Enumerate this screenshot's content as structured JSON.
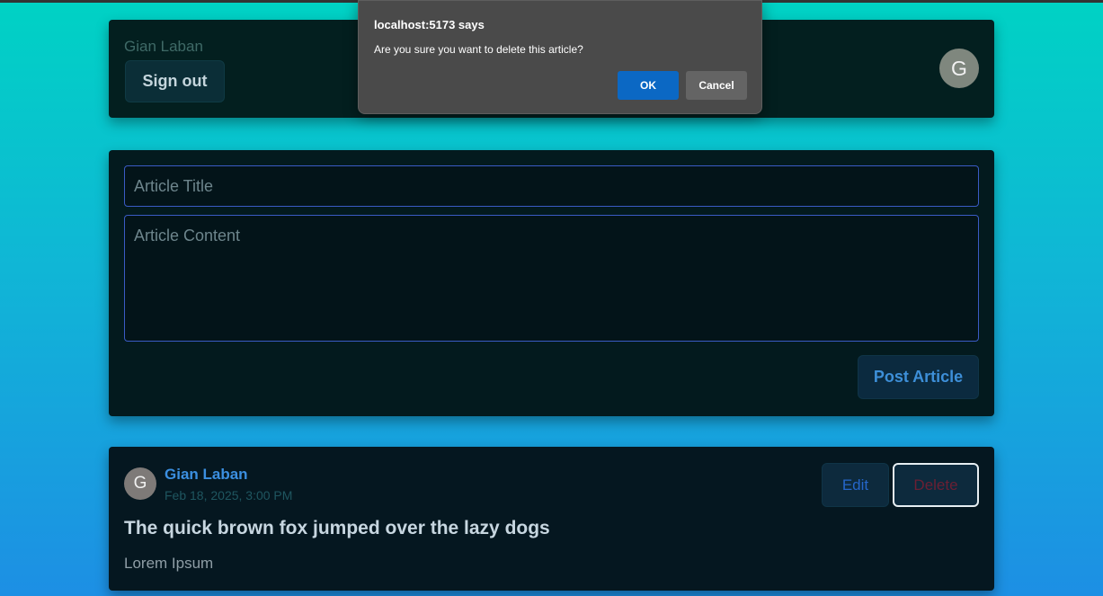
{
  "header": {
    "user_name": "Gian Laban",
    "signout_label": "Sign out",
    "avatar_letter": "G"
  },
  "form": {
    "title_placeholder": "Article Title",
    "content_placeholder": "Article Content",
    "title_value": "",
    "content_value": "",
    "post_label": "Post Article"
  },
  "article": {
    "avatar_letter": "G",
    "author": "Gian Laban",
    "date": "Feb 18, 2025, 3:00 PM",
    "edit_label": "Edit",
    "delete_label": "Delete",
    "title": "The quick brown fox jumped over the lazy dogs",
    "body": "Lorem Ipsum"
  },
  "dialog": {
    "title": "localhost:5173 says",
    "message": "Are you sure you want to delete this article?",
    "ok_label": "OK",
    "cancel_label": "Cancel"
  },
  "colors": {
    "accent_blue": "#3b8fe0",
    "dialog_ok": "#0b68c4",
    "delete_text": "#6b1f33"
  }
}
